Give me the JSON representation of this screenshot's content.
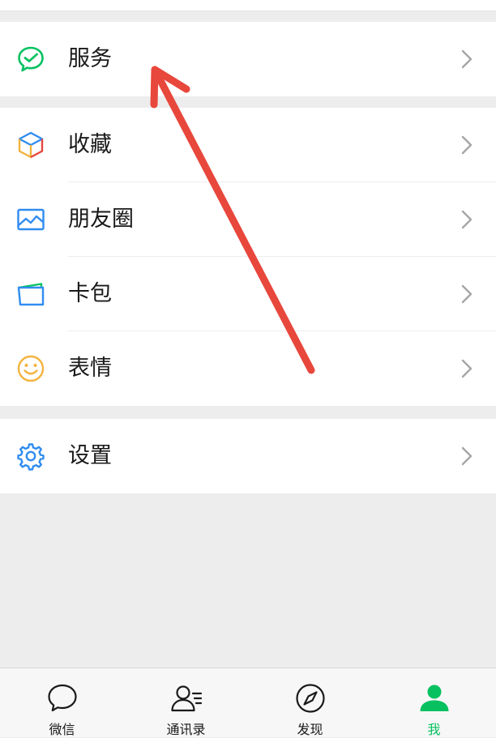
{
  "menu": {
    "services": {
      "label": "服务",
      "icon": "wechat-pay-icon"
    },
    "favorites": {
      "label": "收藏",
      "icon": "cube-icon"
    },
    "moments": {
      "label": "朋友圈",
      "icon": "image-icon"
    },
    "cards": {
      "label": "卡包",
      "icon": "wallet-icon"
    },
    "stickers": {
      "label": "表情",
      "icon": "smile-icon"
    },
    "settings": {
      "label": "设置",
      "icon": "gear-icon"
    }
  },
  "tabbar": {
    "tabs": [
      {
        "label": "微信",
        "icon": "chat-bubble-icon",
        "active": false
      },
      {
        "label": "通讯录",
        "icon": "contacts-icon",
        "active": false
      },
      {
        "label": "发现",
        "icon": "compass-icon",
        "active": false
      },
      {
        "label": "我",
        "icon": "person-icon",
        "active": true
      }
    ]
  },
  "colors": {
    "accent": "#07c160",
    "annotation_arrow": "#e8473c",
    "background": "#ededed"
  }
}
